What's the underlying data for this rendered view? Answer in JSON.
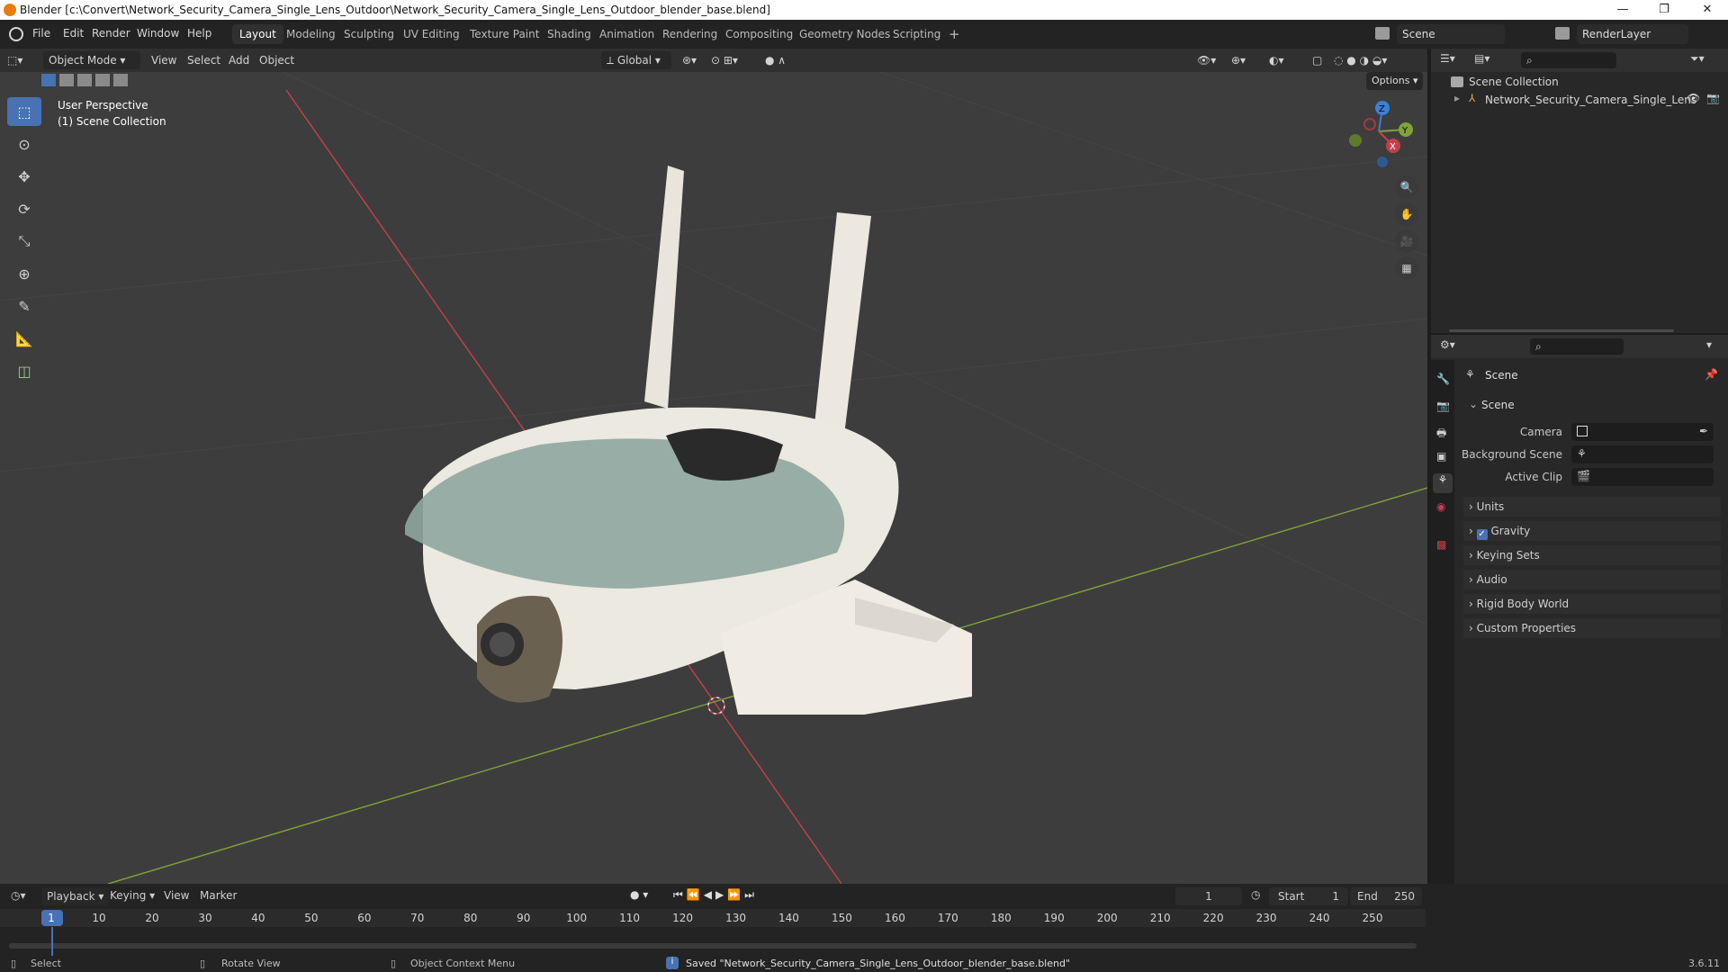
{
  "titlebar": {
    "title": "Blender [c:\\Convert\\Network_Security_Camera_Single_Lens_Outdoor\\Network_Security_Camera_Single_Lens_Outdoor_blender_base.blend]",
    "min": "—",
    "max": "❐",
    "close": "✕"
  },
  "menu": {
    "items": [
      "File",
      "Edit",
      "Render",
      "Window",
      "Help"
    ]
  },
  "workspaces": {
    "tabs": [
      "Layout",
      "Modeling",
      "Sculpting",
      "UV Editing",
      "Texture Paint",
      "Shading",
      "Animation",
      "Rendering",
      "Compositing",
      "Geometry Nodes",
      "Scripting"
    ],
    "active": "Layout",
    "add": "+"
  },
  "scene": {
    "label": "Scene",
    "renderlayer": "RenderLayer"
  },
  "viewport_header": {
    "mode": "Object Mode",
    "view": "View",
    "select": "Select",
    "add": "Add",
    "object": "Object",
    "orientation": "Global",
    "options": "Options"
  },
  "viewport": {
    "perspective": "User Perspective",
    "collection": "(1) Scene Collection",
    "gizmo": {
      "x": "X",
      "y": "Y",
      "z": "Z"
    }
  },
  "outliner": {
    "root": "Scene Collection",
    "item": "Network_Security_Camera_Single_Lens"
  },
  "properties": {
    "context": "Scene",
    "section": "Scene",
    "fields": [
      {
        "label": "Camera"
      },
      {
        "label": "Background Scene"
      },
      {
        "label": "Active Clip"
      }
    ],
    "panels": [
      "Units",
      "Gravity",
      "Keying Sets",
      "Audio",
      "Rigid Body World",
      "Custom Properties"
    ],
    "gravity_checked": true
  },
  "timeline": {
    "menus": [
      "Playback",
      "Keying",
      "View",
      "Marker"
    ],
    "current_frame": "1",
    "start_label": "Start",
    "start": "1",
    "end_label": "End",
    "end": "250",
    "ticks": [
      "1",
      "10",
      "20",
      "30",
      "40",
      "50",
      "60",
      "70",
      "80",
      "90",
      "100",
      "110",
      "120",
      "130",
      "140",
      "150",
      "160",
      "170",
      "180",
      "190",
      "200",
      "210",
      "220",
      "230",
      "240",
      "250"
    ]
  },
  "status": {
    "select": "Select",
    "rotate": "Rotate View",
    "context_menu": "Object Context Menu",
    "message": "Saved \"Network_Security_Camera_Single_Lens_Outdoor_blender_base.blend\"",
    "version": "3.6.11"
  },
  "colors": {
    "accent": "#4772b3",
    "x_axis": "#c6404b",
    "y_axis": "#7fa33a",
    "z_axis": "#3b7fd6"
  }
}
